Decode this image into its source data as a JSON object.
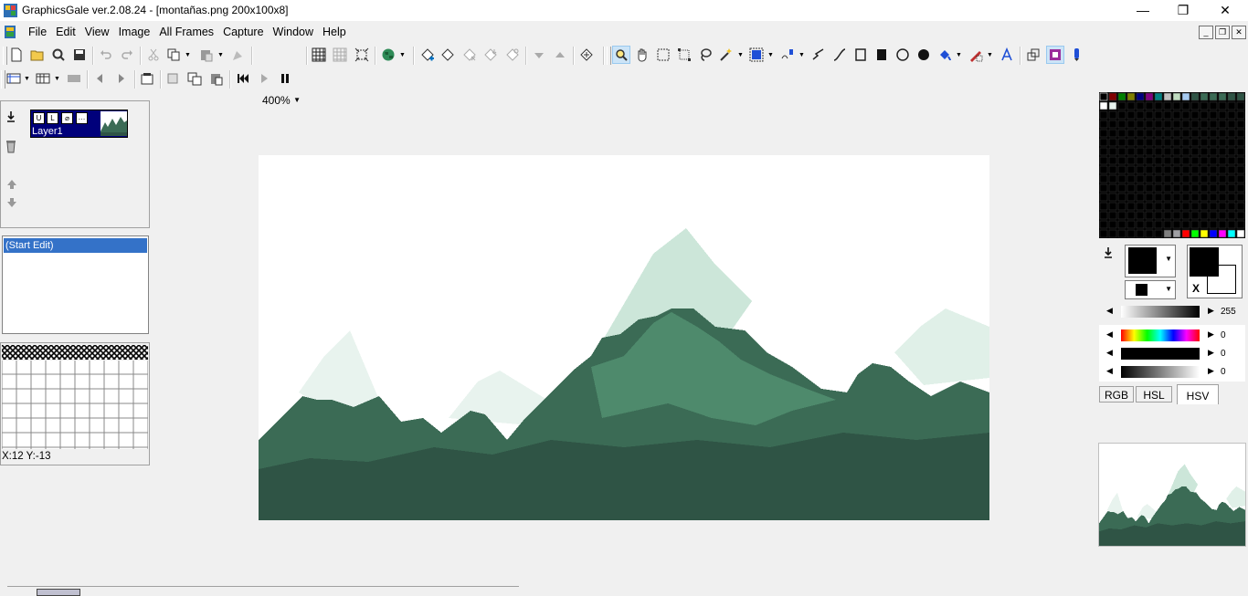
{
  "window": {
    "title": "GraphicsGale ver.2.08.24 - [montañas.png 200x100x8]",
    "minimize_glyph": "—",
    "restore_glyph": "❐",
    "close_glyph": "✕"
  },
  "menu": [
    "File",
    "Edit",
    "View",
    "Image",
    "All Frames",
    "Capture",
    "Window",
    "Help"
  ],
  "toolbar": {
    "zoom": "400%",
    "selected_tool": "zoom-icon"
  },
  "layers": {
    "items": [
      {
        "label": "Layer1",
        "selected": true
      }
    ]
  },
  "history": {
    "items": [
      "(Start Edit)"
    ]
  },
  "status": {
    "coords": "X:12 Y:-13"
  },
  "color_panel": {
    "alpha_value": "255",
    "h_value": "0",
    "s_value": "0",
    "v_value": "0",
    "tabs": [
      "RGB",
      "HSL",
      "HSV"
    ],
    "active_tab": "HSV",
    "transparent_marker": "X",
    "primary_color": "#000000",
    "secondary_color": "#ffffff"
  },
  "colors": {
    "sky": "#ffffff",
    "snow_light": "#e8f3ee",
    "snow_mid": "#cce6d9",
    "mountain_dark": "#2f5445",
    "mountain_mid": "#3b6b55",
    "mountain_light": "#4e8a6c",
    "accent_selection": "#00007b",
    "history_selection": "#3472c8"
  }
}
